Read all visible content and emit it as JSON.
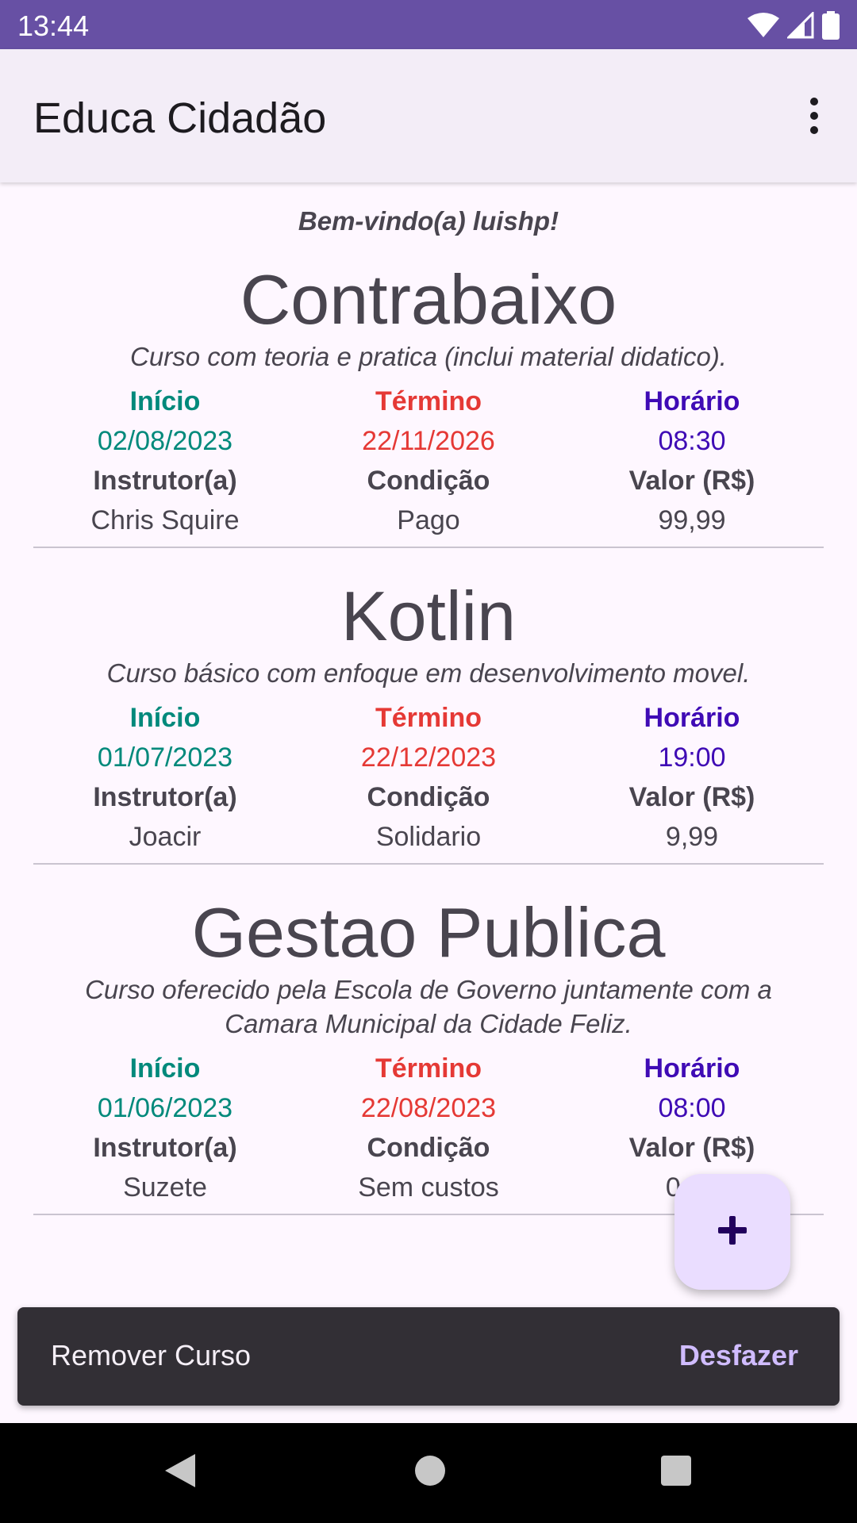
{
  "status_bar": {
    "time": "13:44"
  },
  "app_bar": {
    "title": "Educa Cidadão",
    "menu_icon": "more-vert-icon"
  },
  "welcome": "Bem-vindo(a) luishp!",
  "field_labels": {
    "start": "Início",
    "end": "Término",
    "time": "Horário",
    "instructor": "Instrutor(a)",
    "condition": "Condição",
    "price": "Valor (R$)"
  },
  "courses": [
    {
      "name": "Contrabaixo",
      "description": "Curso com teoria e pratica (inclui material didatico).",
      "start": "02/08/2023",
      "end": "22/11/2026",
      "time": "08:30",
      "instructor": "Chris Squire",
      "condition": "Pago",
      "price": "99,99"
    },
    {
      "name": "Kotlin",
      "description": "Curso básico com enfoque em desenvolvimento movel.",
      "start": "01/07/2023",
      "end": "22/12/2023",
      "time": "19:00",
      "instructor": "Joacir",
      "condition": "Solidario",
      "price": "9,99"
    },
    {
      "name": "Gestao Publica",
      "description": "Curso oferecido pela Escola de Governo juntamente com a Camara Municipal da Cidade Feliz.",
      "start": "01/06/2023",
      "end": "22/08/2023",
      "time": "08:00",
      "instructor": "Suzete",
      "condition": "Sem custos",
      "price": "0,00"
    }
  ],
  "fab": {
    "icon": "add-icon"
  },
  "snackbar": {
    "message": "Remover Curso",
    "action": "Desfazer"
  },
  "colors": {
    "status_bar": "#6750A4",
    "start": "#00897B",
    "end": "#E53935",
    "time": "#3F0BB5",
    "snack_action": "#D0BCFF"
  }
}
